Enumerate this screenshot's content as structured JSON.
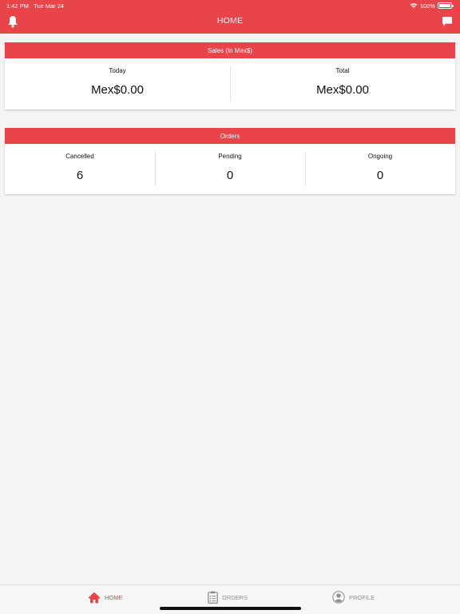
{
  "status_bar": {
    "time": "1:42 PM",
    "date": "Tue Mar 24",
    "battery": "100%",
    "battery_level": 1.0,
    "icons": [
      "wifi-icon",
      "battery-icon"
    ]
  },
  "header": {
    "title": "HOME",
    "left_icon": "bell-icon",
    "right_icon": "chat-icon"
  },
  "sales": {
    "title": "Sales (In Mex$)",
    "stats": [
      {
        "label": "Today",
        "value": "Mex$0.00"
      },
      {
        "label": "Total",
        "value": "Mex$0.00"
      }
    ]
  },
  "orders": {
    "title": "Orders",
    "stats": [
      {
        "label": "Cancelled",
        "value": "6"
      },
      {
        "label": "Pending",
        "value": "0"
      },
      {
        "label": "Ongoing",
        "value": "0"
      }
    ]
  },
  "tabbar": {
    "tabs": [
      {
        "label": "HOME",
        "icon": "home-icon",
        "active": true
      },
      {
        "label": "ORDERS",
        "icon": "clipboard-icon",
        "active": false
      },
      {
        "label": "PROFILE",
        "icon": "user-icon",
        "active": false
      }
    ]
  },
  "colors": {
    "accent": "#ea444b",
    "background": "#f4f4f4",
    "inactive_tab": "#8e8e8e"
  }
}
